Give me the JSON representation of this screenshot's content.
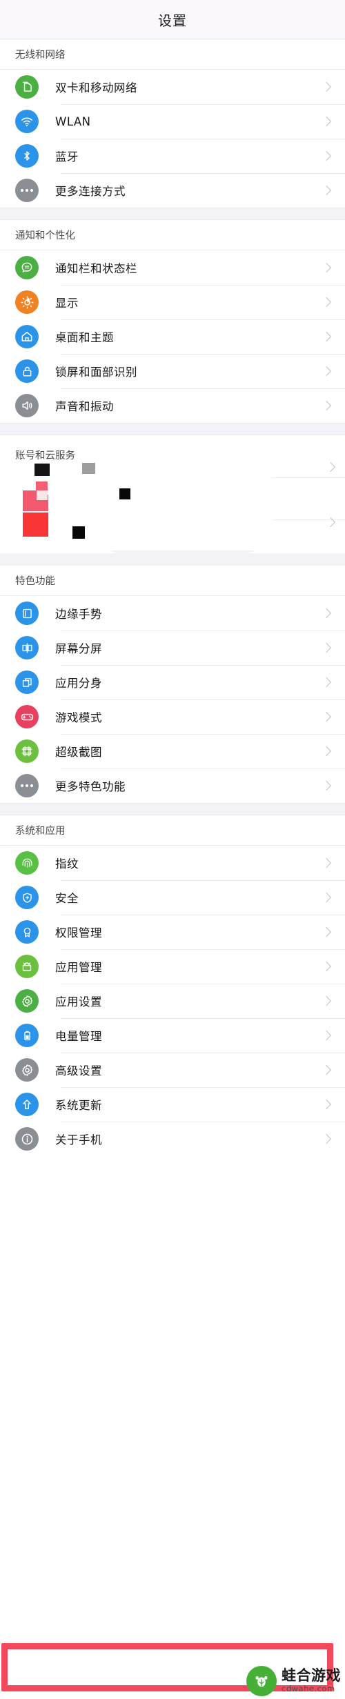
{
  "header": {
    "title": "设置"
  },
  "sections": [
    {
      "id": "wireless",
      "title": "无线和网络",
      "rows": [
        {
          "label": "双卡和移动网络",
          "icon": "sim-card-icon",
          "color": "#4caf44"
        },
        {
          "label": "WLAN",
          "icon": "wifi-icon",
          "color": "#2b93e8"
        },
        {
          "label": "蓝牙",
          "icon": "bluetooth-icon",
          "color": "#2b93e8"
        },
        {
          "label": "更多连接方式",
          "icon": "more-dots-icon",
          "color": "#8b8f94"
        }
      ]
    },
    {
      "id": "notification",
      "title": "通知和个性化",
      "rows": [
        {
          "label": "通知栏和状态栏",
          "icon": "chat-bubble-icon",
          "color": "#4caf44"
        },
        {
          "label": "显示",
          "icon": "brightness-icon",
          "color": "#f08223"
        },
        {
          "label": "桌面和主题",
          "icon": "home-icon",
          "color": "#2b93e8"
        },
        {
          "label": "锁屏和面部识别",
          "icon": "lock-icon",
          "color": "#2b93e8"
        },
        {
          "label": "声音和振动",
          "icon": "speaker-icon",
          "color": "#8b8f94"
        }
      ]
    },
    {
      "id": "account",
      "title": "账号和云服务",
      "corrupted": true,
      "rows": [
        {
          "label": "",
          "icon": "corrupted-icon",
          "color": "#f4495c"
        },
        {
          "label": "",
          "icon": "corrupted-icon",
          "color": "#f42b2b"
        }
      ]
    },
    {
      "id": "features",
      "title": "特色功能",
      "rows": [
        {
          "label": "边缘手势",
          "icon": "edge-gesture-icon",
          "color": "#2b93e8"
        },
        {
          "label": "屏幕分屏",
          "icon": "split-screen-icon",
          "color": "#2b93e8"
        },
        {
          "label": "应用分身",
          "icon": "app-clone-icon",
          "color": "#2b93e8"
        },
        {
          "label": "游戏模式",
          "icon": "gamepad-icon",
          "color": "#e8405f"
        },
        {
          "label": "超级截图",
          "icon": "screenshot-icon",
          "color": "#6cc040"
        },
        {
          "label": "更多特色功能",
          "icon": "more-dots-icon",
          "color": "#8b8f94"
        }
      ]
    },
    {
      "id": "system",
      "title": "系统和应用",
      "rows": [
        {
          "label": "指纹",
          "icon": "fingerprint-icon",
          "color": "#58c145"
        },
        {
          "label": "安全",
          "icon": "shield-plus-icon",
          "color": "#2b93e8"
        },
        {
          "label": "权限管理",
          "icon": "permission-badge-icon",
          "color": "#2b93e8"
        },
        {
          "label": "应用管理",
          "icon": "android-icon",
          "color": "#6cc040"
        },
        {
          "label": "应用设置",
          "icon": "gear-icon",
          "color": "#4caf44"
        },
        {
          "label": "电量管理",
          "icon": "battery-icon",
          "color": "#2b93e8"
        },
        {
          "label": "高级设置",
          "icon": "gear-icon",
          "color": "#8b8f94"
        },
        {
          "label": "系统更新",
          "icon": "arrow-up-icon",
          "color": "#2b93e8"
        },
        {
          "label": "关于手机",
          "icon": "info-icon",
          "color": "#8b8f94",
          "highlighted": true
        }
      ]
    }
  ],
  "highlight": {
    "color": "#f4495c"
  },
  "watermark": {
    "name": "蛙合游戏",
    "url": "cdwahe.com"
  }
}
